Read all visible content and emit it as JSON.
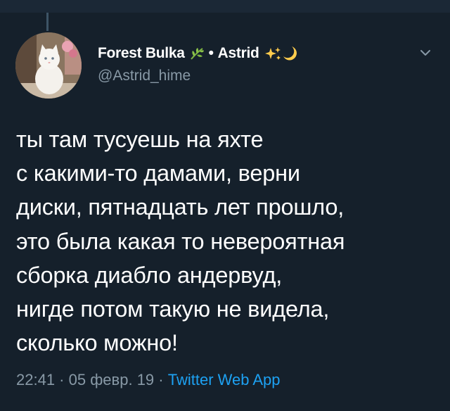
{
  "tweet": {
    "display_name": "Forest Bulka",
    "name_separator": "•",
    "display_name_2": "Astrid",
    "handle": "@Astrid_hime",
    "text": "ты там тусуешь на яхте\nс какими-то дамами, верни\nдиски, пятнадцать лет прошло,\nэто была какая то невероятная\nсборка диабло андервуд,\nнигде потом такую не видела,\nсколько можно!",
    "time": "22:41",
    "date": "05 февр. 19",
    "dot": " · ",
    "source": "Twitter Web App"
  },
  "icons": {
    "name_emoji_1": "herb-icon",
    "name_emoji_2": "sparkles-icon",
    "name_emoji_3": "crescent-moon-icon",
    "menu": "chevron-down-icon"
  },
  "colors": {
    "background": "#15202b",
    "text_primary": "#ffffff",
    "text_secondary": "#8899a6",
    "link": "#1da1f2"
  }
}
